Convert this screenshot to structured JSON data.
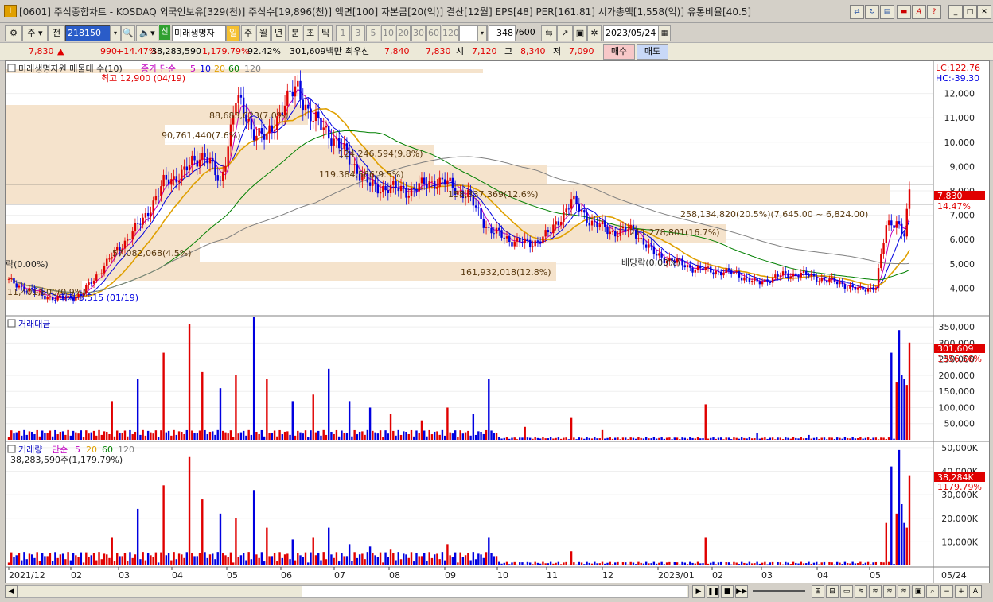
{
  "window": {
    "title": "[0601] 주식종합차트 - KOSDAQ 외국인보유[329(천)] 주식수[19,896(천)] 액면[100] 자본금[20(억)] 결산[12월] EPS[48] PER[161.81] 시가총액[1,558(억)] 유통비율[40.5]",
    "icon": "I"
  },
  "toolbar": {
    "period": "주",
    "prev_label": "전",
    "code": "218150",
    "credit_badge": "신",
    "stock_name": "미래생명자",
    "intervals": [
      "일",
      "주",
      "월",
      "년",
      "분",
      "초",
      "틱"
    ],
    "active_interval": "일",
    "multipliers": [
      "1",
      "3",
      "5",
      "10",
      "20",
      "30",
      "60",
      "120"
    ],
    "count": "348",
    "count_total": "/600",
    "date": "2023/05/24"
  },
  "quote": {
    "price": "7,830",
    "change_arrow": "▲",
    "change": "990",
    "change_pct": "+14.47%",
    "volume": "38,283,590",
    "volume_pct": "1,179.79%",
    "exec_strength": "92.42%",
    "amount": "301,609백만",
    "best_label": "최우선",
    "ask": "7,840",
    "bid": "7,830",
    "open_label": "시",
    "open": "7,120",
    "high_label": "고",
    "high": "8,340",
    "low_label": "저",
    "low": "7,090",
    "buy_btn": "매수",
    "sell_btn": "매도"
  },
  "colors": {
    "up": "#e00000",
    "down": "#0000e0",
    "ma5": "#c000c0",
    "ma10": "#0000e0",
    "ma20": "#e0a000",
    "ma60": "#008000",
    "ma120": "#808080",
    "band": "#f5e3cc"
  },
  "price_panel": {
    "legend_name": "미래생명자원 매물대 수(10)",
    "ma_label": "종가 단순",
    "ma_periods": [
      "5",
      "10",
      "20",
      "60",
      "120"
    ],
    "lc_label": "LC:122.76",
    "hc_label": "HC:-39.30",
    "high_marker": "최고 12,900 (04/19)",
    "low_marker": "최저 3,515 (01/19)",
    "dividend_marker": "배당락(0.00%)",
    "left_marker": "락(0.00%)",
    "current_price": "7,830",
    "current_pct": "14.47%",
    "y_ticks": [
      "12,000",
      "11,000",
      "10,000",
      "9,000",
      "8,000",
      "7,000",
      "6,000",
      "5,000",
      "4,000"
    ],
    "volume_profile": [
      "88,683,623(7.0%)",
      "90,761,440(7.6%)",
      "124,246,594(9.8%)",
      "119,384,566(9.5%)",
      "158,337,369(12.6%)",
      "258,134,820(20.5%)(7,645.00 ~ 6,824.00)",
      "211,278,801(16.7%)",
      "57,082,068(4.5%)",
      "161,932,018(12.8%)",
      "11,401,800(0.9%)"
    ]
  },
  "amount_panel": {
    "title": "거래대금",
    "current": "301,609",
    "current_pct": "1356.56%",
    "y_ticks": [
      "350,000",
      "300,000",
      "250,000",
      "200,000",
      "150,000",
      "100,000",
      "50,000"
    ]
  },
  "volume_panel": {
    "title": "거래량",
    "ma_label": "단순",
    "ma_periods": [
      "5",
      "20",
      "60",
      "120"
    ],
    "current_text": "38,283,590주(1,179.79%)",
    "current": "38,284K",
    "current_pct": "1179.79%",
    "y_ticks": [
      "50,000K",
      "40,000K",
      "30,000K",
      "20,000K",
      "10,000K"
    ]
  },
  "x_axis": {
    "labels": [
      "2021/12",
      "02",
      "03",
      "04",
      "05",
      "06",
      "07",
      "08",
      "09",
      "10",
      "11",
      "12",
      "2023/01",
      "02",
      "03",
      "04",
      "05"
    ],
    "right_label": "05/24"
  }
}
